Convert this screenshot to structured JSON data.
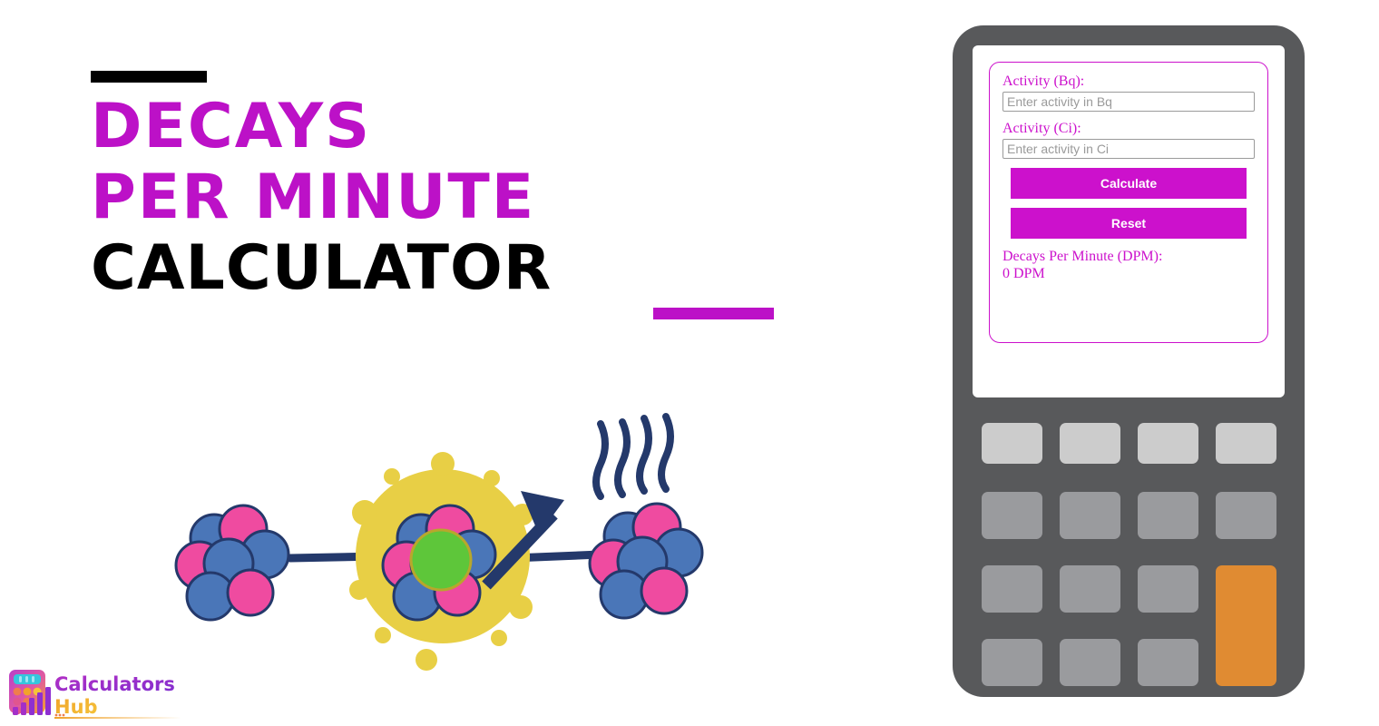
{
  "page": {
    "title_lines": [
      {
        "text": "DECAYS",
        "color": "#bc11c7"
      },
      {
        "text": "PER MINUTE",
        "color": "#bc11c7"
      },
      {
        "text": "CALCULATOR",
        "color": "#000000"
      }
    ],
    "accent_color": "#bc11c7",
    "rule_top_color": "#000000",
    "rule_bottom_color": "#bc11c7",
    "background": "#ffffff"
  },
  "brand": {
    "name_part1": "Calculators",
    "name_part2": "Hub",
    "part1_color": "#a21fc4",
    "part2_color": "#f2a32a",
    "icon": "calculator-bars-logo"
  },
  "illustration": {
    "name": "nuclear-decay-diagram",
    "nucleon_pink": "#ef4ba0",
    "nucleon_blue": "#4a76b8",
    "outline": "#24396b",
    "glow": "#e8cf45",
    "core_green": "#5ec63a",
    "radiation_color": "#24396b"
  },
  "phone": {
    "frame_color": "#58595b",
    "screen_color": "#ffffff"
  },
  "calculator": {
    "card_border_color": "#cc11cc",
    "fields": [
      {
        "label": "Activity (Bq):",
        "placeholder": "Enter activity in Bq",
        "value": ""
      },
      {
        "label": "Activity (Ci):",
        "placeholder": "Enter activity in Ci",
        "value": ""
      }
    ],
    "buttons": [
      {
        "label": "Calculate",
        "color": "#cc11cc"
      },
      {
        "label": "Reset",
        "color": "#cc11cc"
      }
    ],
    "result": {
      "label": "Decays Per Minute (DPM):",
      "value": "0 DPM"
    }
  },
  "keypad": {
    "light_key_color": "#cccccc",
    "mid_key_color": "#9a9b9e",
    "accent_key_color": "#e08b32",
    "rows": 4,
    "columns": 4
  }
}
